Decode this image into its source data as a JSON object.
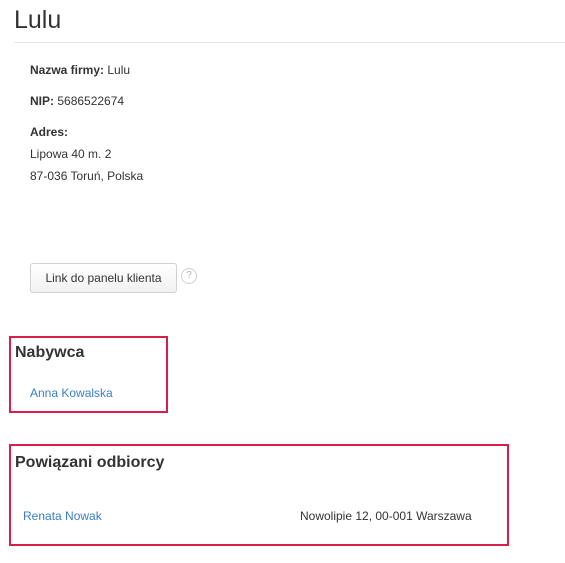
{
  "page": {
    "title": "Lulu"
  },
  "company": {
    "name_label": "Nazwa firmy:",
    "name_value": "Lulu",
    "nip_label": "NIP:",
    "nip_value": "5686522674",
    "address_label": "Adres:",
    "address_line1": "Lipowa 40 m. 2",
    "address_line2": "87-036 Toruń, Polska"
  },
  "client_panel": {
    "button_label": "Link do panelu klienta",
    "help_icon": "question-icon",
    "help_glyph": "?"
  },
  "buyer": {
    "heading": "Nabywca",
    "name": "Anna Kowalska"
  },
  "recipients": {
    "heading": "Powiązani odbiorcy",
    "items": [
      {
        "name": "Renata Nowak",
        "address": "Nowolipie 12, 00-001 Warszawa"
      }
    ]
  },
  "colors": {
    "highlight_border": "#d61f4b",
    "link": "#3a7fc4",
    "text": "#333333"
  }
}
